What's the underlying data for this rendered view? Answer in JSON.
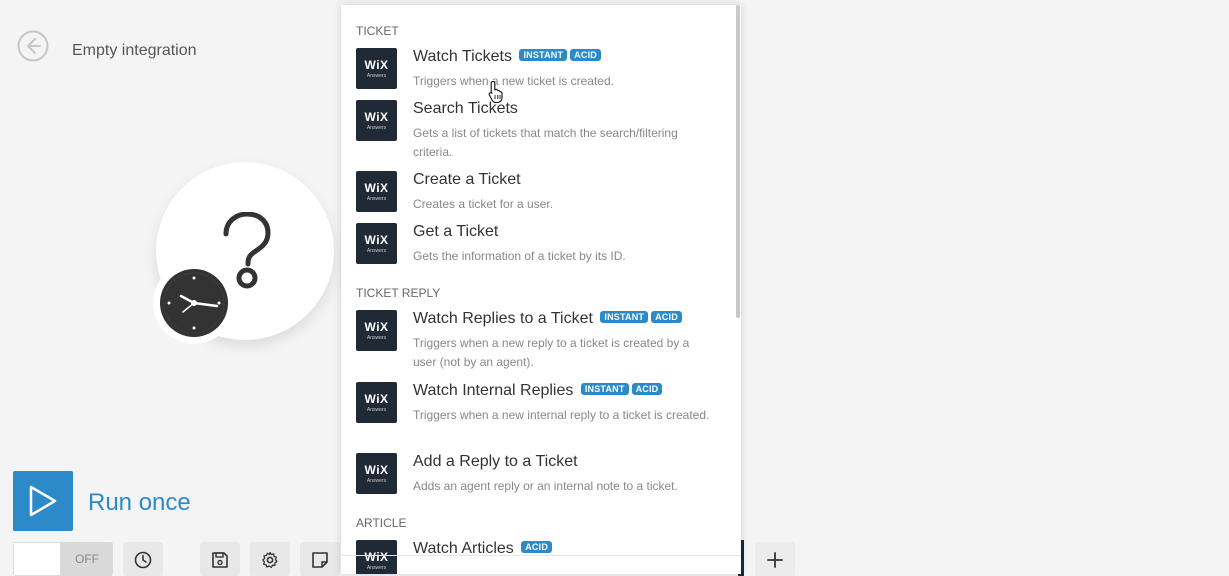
{
  "header": {
    "integration_title": "Empty integration"
  },
  "run_once": {
    "label": "Run once"
  },
  "toolbar": {
    "toggle_state": "OFF"
  },
  "menu": {
    "sections": [
      {
        "title": "TICKET"
      },
      {
        "title": "TICKET REPLY"
      },
      {
        "title": "ARTICLE"
      }
    ],
    "logo": {
      "brand": "WiX",
      "sub": "Answers"
    },
    "items": [
      {
        "name": "Watch Tickets",
        "badges": [
          "INSTANT",
          "ACID"
        ],
        "desc": "Triggers when a new ticket is created."
      },
      {
        "name": "Search Tickets",
        "badges": [],
        "desc": "Gets a list of tickets that match the search/filtering criteria."
      },
      {
        "name": "Create a Ticket",
        "badges": [],
        "desc": "Creates a ticket for a user."
      },
      {
        "name": "Get a Ticket",
        "badges": [],
        "desc": "Gets the information of a ticket by its ID."
      },
      {
        "name": "Watch Replies to a Ticket",
        "badges": [
          "INSTANT",
          "ACID"
        ],
        "desc": "Triggers when a new reply to a ticket is created by a user (not by an agent)."
      },
      {
        "name": "Watch Internal Replies",
        "badges": [
          "INSTANT",
          "ACID"
        ],
        "desc": "Triggers when a new internal reply to a ticket is created."
      },
      {
        "name": "Add a Reply to a Ticket",
        "badges": [],
        "desc": "Adds an agent reply or an internal note to a ticket."
      },
      {
        "name": "Watch Articles",
        "badges": [
          "ACID"
        ],
        "desc": ""
      }
    ]
  },
  "icons": {
    "back": "back-arrow-icon",
    "question": "question-mark-icon",
    "clock": "clock-icon",
    "play": "play-icon",
    "history": "history-clock-icon",
    "save": "save-icon",
    "settings": "gear-icon",
    "note": "note-icon",
    "add": "plus-icon"
  },
  "colors": {
    "accent": "#2d8ac8",
    "logo_bg": "#1f2a36",
    "background": "#f4f4f4"
  }
}
